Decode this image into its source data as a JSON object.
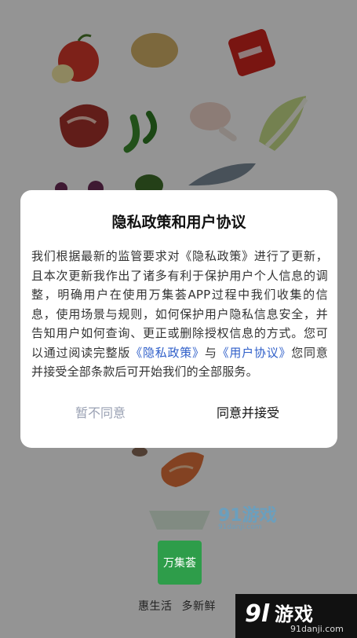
{
  "dialog": {
    "title": "隐私政策和用户协议",
    "body_part1": "我们根据最新的监管要求对《隐私政策》进行了更新，且本次更新我作出了诸多有利于保护用户个人信息的调整，明确用户在使用万集荟APP过程中我们收集的信息，使用场景与规则，如何保护用户隐私信息安全，并告知用户如何查询、更正或删除授权信息的方式。您可以通过阅读完整版",
    "privacy_link": "《隐私政策》",
    "body_and": "与",
    "terms_link": "《用户协议》",
    "body_part2": "您同意并接受全部条款后可开始我们的全部服务。",
    "decline_label": "暂不同意",
    "accept_label": "同意并接受",
    "link_color": "#2f5fc9"
  },
  "app": {
    "logo_text": "万集荟",
    "slogan_1": "惠生活",
    "slogan_2": "多新鲜",
    "brand_color": "#2e9d4a"
  },
  "watermark": {
    "mark_top": "91",
    "name_top": "游戏",
    "url_top": "91danji.com",
    "mark_bottom": "9l",
    "name_bottom": "游戏",
    "url_bottom": "91danji.com"
  }
}
